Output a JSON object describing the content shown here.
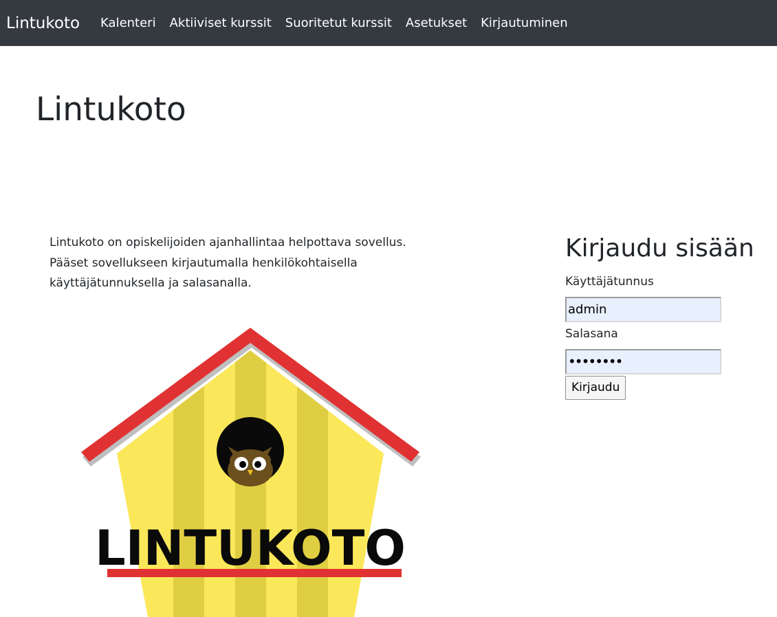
{
  "navbar": {
    "brand": "Lintukoto",
    "links": [
      {
        "label": "Kalenteri"
      },
      {
        "label": "Aktiiviset kurssit"
      },
      {
        "label": "Suoritetut kurssit"
      },
      {
        "label": "Asetukset"
      },
      {
        "label": "Kirjautuminen"
      }
    ]
  },
  "main": {
    "title": "Lintukoto",
    "intro": "Lintukoto on opiskelijoiden ajanhallintaa helpottava sovellus. Pääset sovellukseen kirjautumalla henkilökohtaisella käyttäjätunnuksella ja salasanalla.",
    "logo_text": "LINTUKOTO"
  },
  "login": {
    "title": "Kirjaudu sisään",
    "username_label": "Käyttäjätunnus",
    "username_value": "admin",
    "password_label": "Salasana",
    "password_value": "••••••••",
    "submit_label": "Kirjaudu"
  },
  "colors": {
    "navbar_bg": "#343a40",
    "roof": "#e03232",
    "house_light": "#fbe85a",
    "house_stripe": "#e0ce42",
    "owl": "#6b4f1d",
    "input_bg": "#e8f0fe"
  }
}
